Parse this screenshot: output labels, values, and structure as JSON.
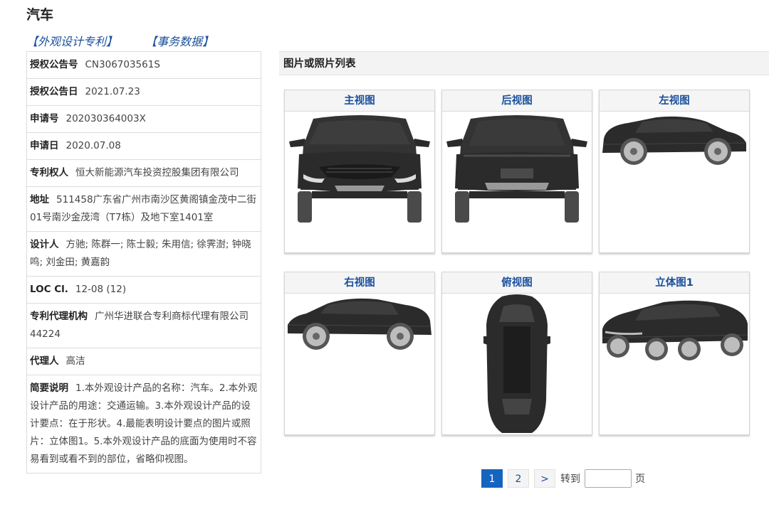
{
  "page_title": "汽车",
  "links": {
    "design_patent": "【外观设计专利】",
    "transaction_data": "【事务数据】"
  },
  "info": {
    "grant_no_label": "授权公告号",
    "grant_no": "CN306703561S",
    "grant_date_label": "授权公告日",
    "grant_date": "2021.07.23",
    "app_no_label": "申请号",
    "app_no": "202030364003X",
    "app_date_label": "申请日",
    "app_date": "2020.07.08",
    "patentee_label": "专利权人",
    "patentee": "恒大新能源汽车投资控股集团有限公司",
    "address_label": "地址",
    "address": "511458广东省广州市南沙区黄阁镇金茂中二街01号南沙金茂湾（T7栋）及地下室1401室",
    "designer_label": "设计人",
    "designer": "方驰; 陈群一; 陈士毅; 朱用信; 徐霁澍; 钟晓鸣; 刘金田; 黄嘉韵",
    "loc_label": "LOC Cl.",
    "loc": "12-08 (12)",
    "agency_label": "专利代理机构",
    "agency": "广州华进联合专利商标代理有限公司44224",
    "agent_label": "代理人",
    "agent": "高洁",
    "brief_label": "简要说明",
    "brief": "1.本外观设计产品的名称：汽车。2.本外观设计产品的用途：交通运输。3.本外观设计产品的设计要点：在于形状。4.最能表明设计要点的图片或照片：立体图1。5.本外观设计产品的底面为使用时不容易看到或看不到的部位，省略仰视图。"
  },
  "images_header": "图片或照片列表",
  "views": [
    {
      "title": "主视图"
    },
    {
      "title": "后视图"
    },
    {
      "title": "左视图"
    },
    {
      "title": "右视图"
    },
    {
      "title": "俯视图"
    },
    {
      "title": "立体图1"
    }
  ],
  "pager": {
    "pages": [
      "1",
      "2"
    ],
    "next": ">",
    "goto_label": "转到",
    "page_unit": "页",
    "page_input_value": ""
  },
  "colors": {
    "link_blue": "#1a4f9c",
    "active_page": "#1565c0",
    "car_body": "#2b2b2b"
  }
}
